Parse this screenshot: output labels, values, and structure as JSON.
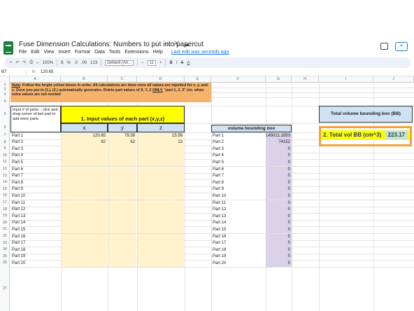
{
  "doc": {
    "title": "Fuse Dimension Calculations: Numbers to put into papercut",
    "menus": [
      "File",
      "Edit",
      "View",
      "Insert",
      "Format",
      "Data",
      "Tools",
      "Extensions",
      "Help"
    ],
    "last_edit": "Last edit was seconds ago"
  },
  "toolbar": {
    "zoom": "100%",
    "currency": "$",
    "percent": "%",
    "dec_decrease": ".0",
    "dec_increase": ".00",
    "format": "123",
    "font": "Default (Ari...",
    "font_size": "11",
    "bold": "B",
    "italic": "I",
    "strike": "S",
    "textcolor": "A"
  },
  "formula_bar": {
    "cell_ref": "B7",
    "fx": "fx",
    "value": "120.65"
  },
  "columns": [
    "A",
    "B",
    "C",
    "D",
    "E",
    "F",
    "G",
    "H",
    "I",
    "J"
  ],
  "rows": [
    "1",
    "2",
    "3",
    "4",
    "5",
    "6",
    "7",
    "8",
    "9",
    "10",
    "11",
    "12",
    "13",
    "14",
    "15",
    "16",
    "17",
    "18",
    "19",
    "20",
    "21",
    "22",
    "23",
    "24",
    "25",
    "26",
    "27"
  ],
  "note": {
    "label": "Note",
    "text": ": Follow the bright yellow boxes in order. All calculations are done once all values are inputted for x, y, and z. Once you put in (1.), (2.) automatically generates. Delete part values of X, Y, Z ",
    "only": "ONLY.",
    "text2": " \"part 1, 2, 3\" etc. when extra values are not needed"
  },
  "input": {
    "label": "Input # of parts: - click and drag corner of last part to add more parts",
    "title": "1. Input values of each part (x,y,z)",
    "headers": [
      "x",
      "y",
      "z"
    ]
  },
  "parts": [
    {
      "name": "Part 1",
      "x": "120.65",
      "y": "79.38",
      "z": "15.56"
    },
    {
      "name": "Part 2",
      "x": "92",
      "y": "62",
      "z": "13"
    },
    {
      "name": "Part 3",
      "x": "",
      "y": "",
      "z": ""
    },
    {
      "name": "Part 4",
      "x": "",
      "y": "",
      "z": ""
    },
    {
      "name": "Part 5",
      "x": "",
      "y": "",
      "z": ""
    },
    {
      "name": "Part 6",
      "x": "",
      "y": "",
      "z": ""
    },
    {
      "name": "Part 7",
      "x": "",
      "y": "",
      "z": ""
    },
    {
      "name": "Part 8",
      "x": "",
      "y": "",
      "z": ""
    },
    {
      "name": "Part 9",
      "x": "",
      "y": "",
      "z": ""
    },
    {
      "name": "Part 10",
      "x": "",
      "y": "",
      "z": ""
    },
    {
      "name": "Part 11",
      "x": "",
      "y": "",
      "z": ""
    },
    {
      "name": "Part 12",
      "x": "",
      "y": "",
      "z": ""
    },
    {
      "name": "Part 13",
      "x": "",
      "y": "",
      "z": ""
    },
    {
      "name": "Part 14",
      "x": "",
      "y": "",
      "z": ""
    },
    {
      "name": "Part 15",
      "x": "",
      "y": "",
      "z": ""
    },
    {
      "name": "Part 16",
      "x": "",
      "y": "",
      "z": ""
    },
    {
      "name": "Part 17",
      "x": "",
      "y": "",
      "z": ""
    },
    {
      "name": "Part 18",
      "x": "",
      "y": "",
      "z": ""
    },
    {
      "name": "Part 19",
      "x": "",
      "y": "",
      "z": ""
    },
    {
      "name": "Part 20",
      "x": "",
      "y": "",
      "z": ""
    }
  ],
  "volume": {
    "title": "volume bounding box",
    "values": [
      "149021.1853",
      "74152",
      "0",
      "0",
      "0",
      "0",
      "0",
      "0",
      "0",
      "0",
      "0",
      "0",
      "0",
      "0",
      "0",
      "0",
      "0",
      "0",
      "0",
      "0"
    ]
  },
  "total": {
    "title": "Total volume bounding box (BB)",
    "label": "2. Total vol BB (cm^3)",
    "value": "223.17"
  }
}
